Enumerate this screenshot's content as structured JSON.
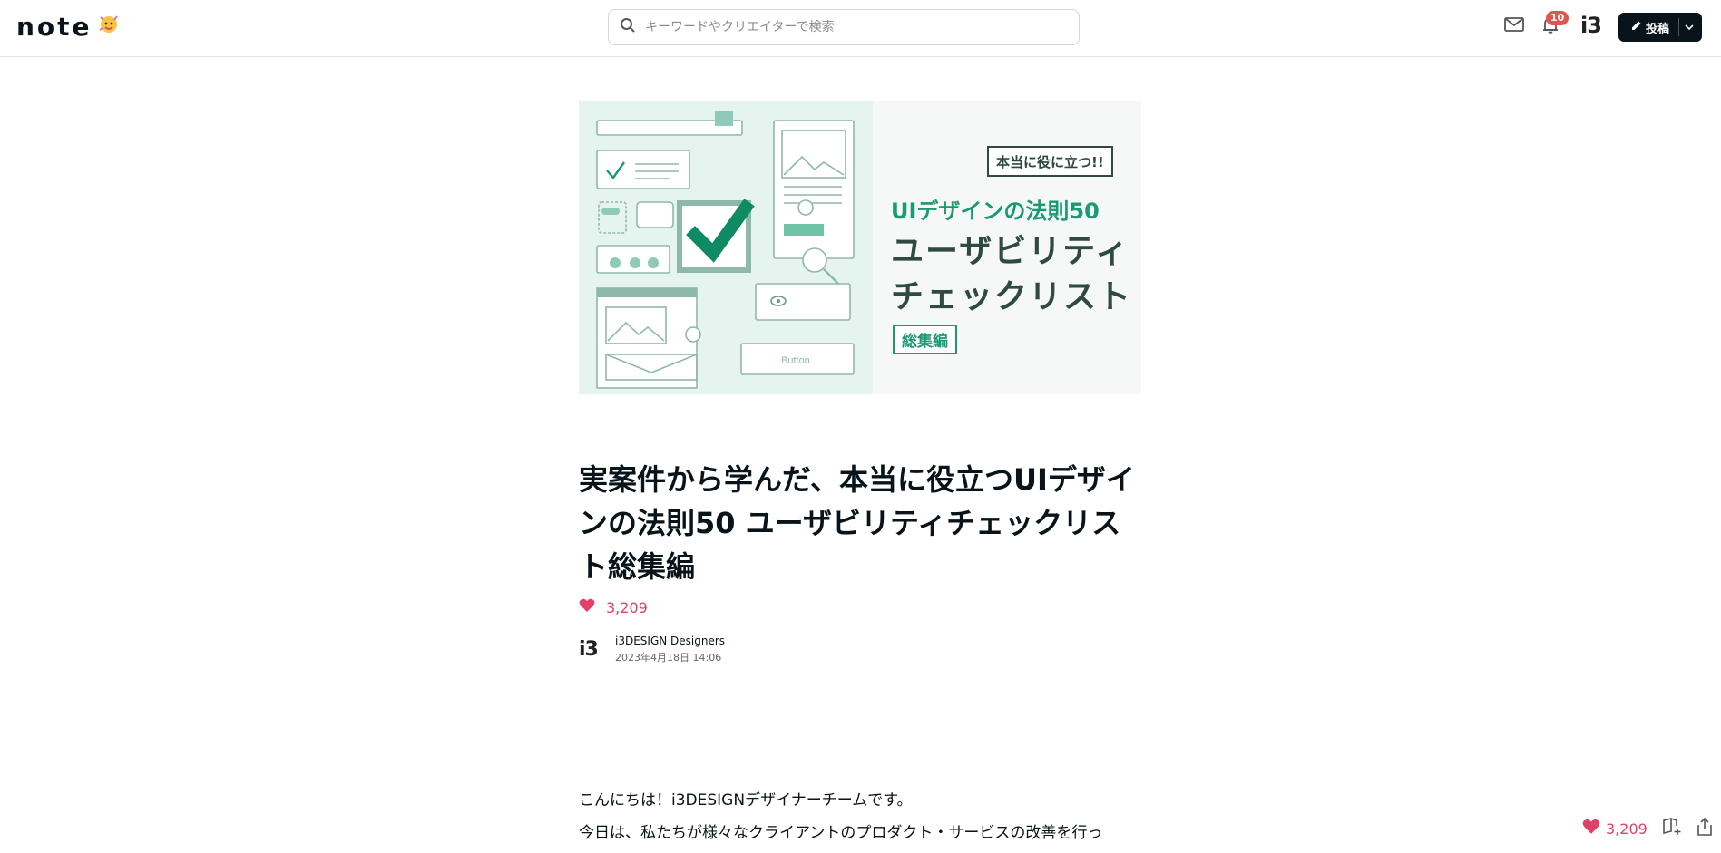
{
  "header": {
    "logo": "note",
    "search_placeholder": "キーワードやクリエイターで検索",
    "notification_count": "10",
    "user_mark": "i3",
    "post_label": "投稿"
  },
  "hero": {
    "tag": "本当に役に立つ!!",
    "subtitle": "UIデザインの法則50",
    "line1": "ユーザビリティ",
    "line2": "チェックリスト",
    "edition": "総集編",
    "button_label": "Button"
  },
  "article": {
    "title": "実案件から学んだ、本当に役立つUIデザインの法則50 ユーザビリティチェックリスト総集編",
    "likes": "3,209",
    "author_mark": "i3",
    "author_name": "i3DESIGN Designers",
    "date": "2023年4月18日 14:06",
    "paragraph1": "こんにちは！i3DESIGNデザイナーチームです。",
    "paragraph2": "今日は、私たちが様々なクライアントのプロダクト・サービスの改善を行っ"
  },
  "float_bar": {
    "likes": "3,209"
  },
  "colors": {
    "accent_green": "#1a9a73",
    "like_red": "#e0416a",
    "dark": "#08131a"
  }
}
